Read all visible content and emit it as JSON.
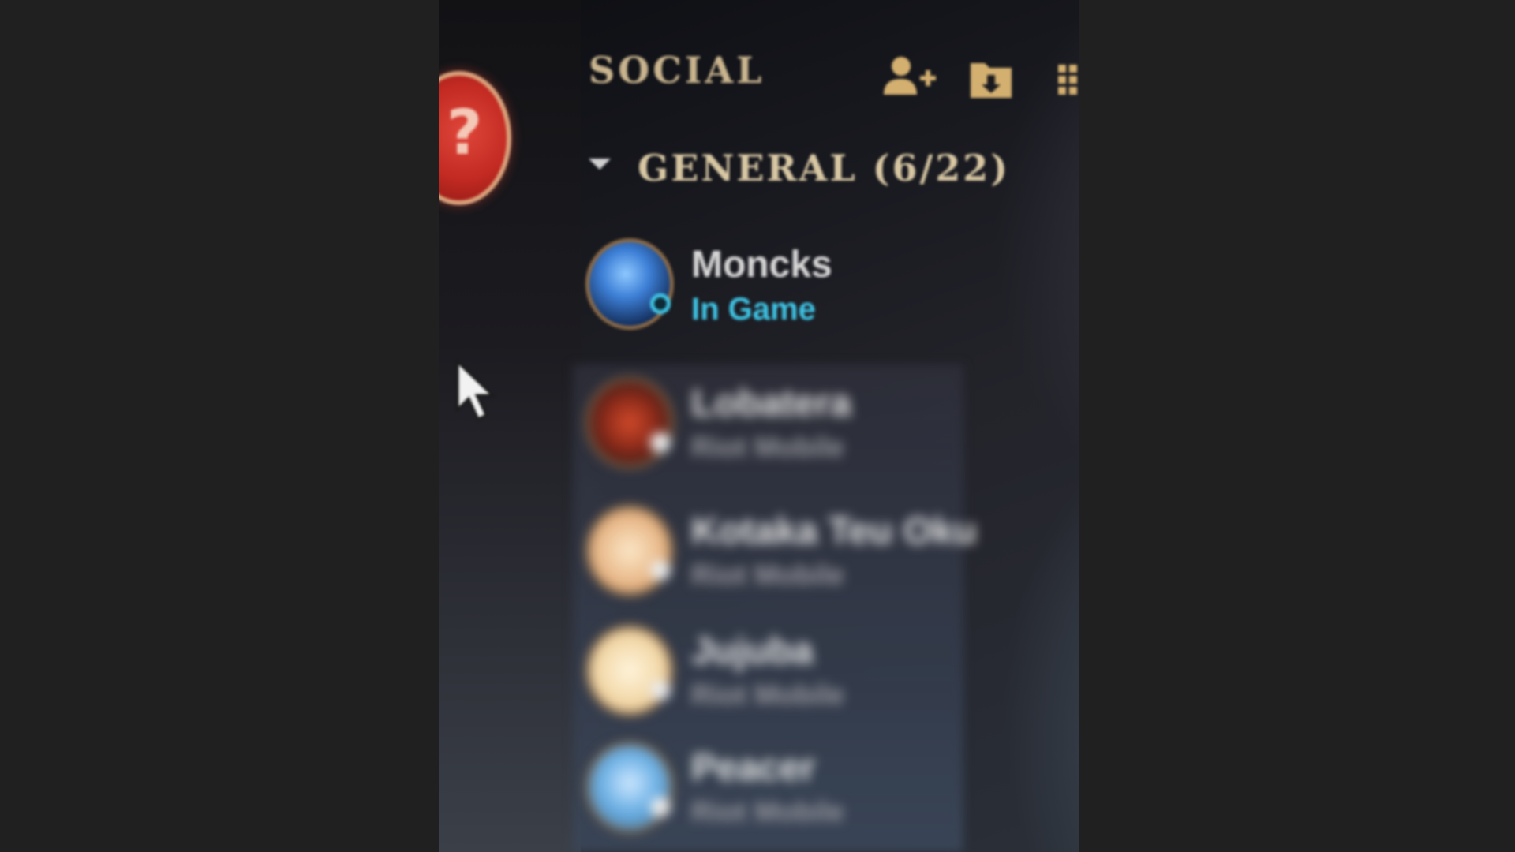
{
  "panel": {
    "title": "SOCIAL"
  },
  "toolbar": {
    "add_friend_icon": "add-friend-icon",
    "add_folder_icon": "add-folder-icon",
    "more_icon": "grid-icon"
  },
  "help_badge": {
    "glyph": "?"
  },
  "group": {
    "title": "GENERAL (6/22)"
  },
  "friends": [
    {
      "name": "Moncks",
      "status": "In Game",
      "status_color": "#3fc7e8"
    },
    {
      "name": "Lobatera",
      "status": "Riot Mobile",
      "status_color": "#9a9aa0"
    },
    {
      "name": "Kotaka Teu Oku",
      "status": "Riot Mobile",
      "status_color": "#9a9aa0"
    },
    {
      "name": "Jujuba",
      "status": "Riot Mobile",
      "status_color": "#9a9aa0"
    },
    {
      "name": "Peacer",
      "status": "Riot Mobile",
      "status_color": "#9a9aa0"
    }
  ],
  "colors": {
    "accent_gold": "#c9b48e",
    "in_game": "#3fc7e8",
    "help_red": "#d6362c"
  }
}
